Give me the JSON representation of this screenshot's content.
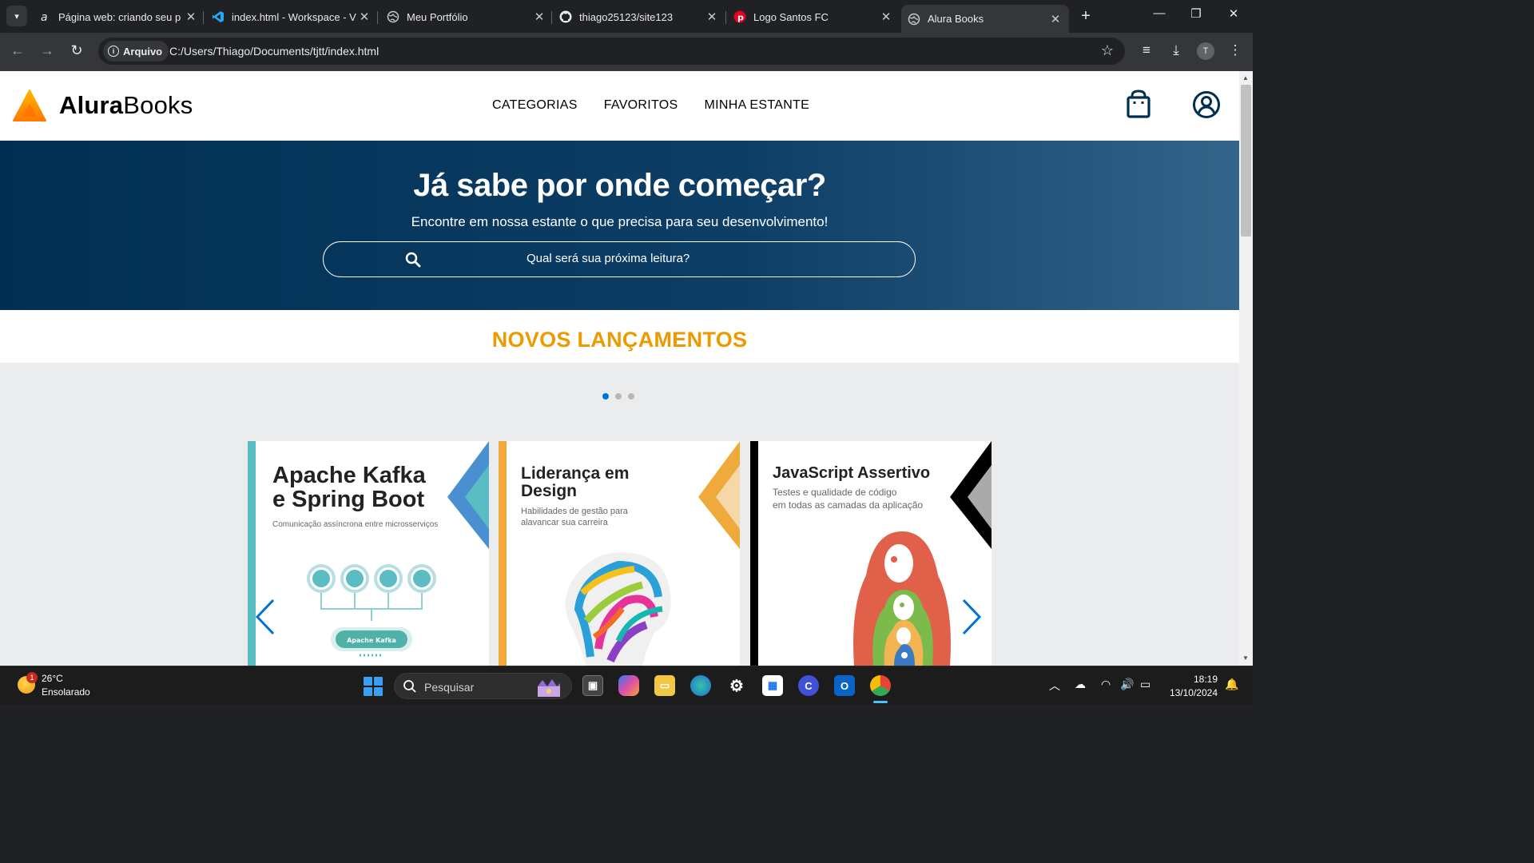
{
  "browser": {
    "tabs": [
      {
        "title": "Página web: criando seu p",
        "icon": "alura-a-icon"
      },
      {
        "title": "index.html - Workspace - V",
        "icon": "vscode-icon"
      },
      {
        "title": "Meu Portfólio",
        "icon": "globe-icon"
      },
      {
        "title": "thiago25123/site123",
        "icon": "github-icon"
      },
      {
        "title": "Logo Santos FC",
        "icon": "pinterest-icon"
      },
      {
        "title": "Alura Books",
        "icon": "globe-icon",
        "active": true
      }
    ],
    "security_chip": "Arquivo",
    "url": "C:/Users/Thiago/Documents/tjtt/index.html",
    "profile_initial": "T"
  },
  "site": {
    "logo_bold": "Alura",
    "logo_regular": "Books",
    "nav": [
      "CATEGORIAS",
      "FAVORITOS",
      "MINHA ESTANTE"
    ],
    "hero": {
      "title": "Já sabe por onde começar?",
      "subtitle": "Encontre em nossa estante o que precisa para seu desenvolvimento!",
      "search_placeholder": "Qual será sua próxima leitura?"
    },
    "section_title": "NOVOS LANÇAMENTOS",
    "carousel": {
      "active_dot": 0,
      "dot_count": 3,
      "books": [
        {
          "title_lines": [
            "Apache Kafka",
            "e Spring Boot"
          ],
          "subtitle_lines": [
            "Comunicação assíncrona entre microsserviços"
          ],
          "accent": "#5bbdc4",
          "diagram_label": "Apache Kafka"
        },
        {
          "title_lines": [
            "Liderança em",
            "Design"
          ],
          "subtitle_lines": [
            "Habilidades de gestão para",
            "alavancar sua carreira"
          ],
          "accent": "#efaa3b"
        },
        {
          "title_lines": [
            "JavaScript Assertivo"
          ],
          "subtitle_lines": [
            "Testes e qualidade de código",
            "em todas as camadas da aplicação"
          ],
          "accent": "#000000"
        }
      ]
    },
    "colors": {
      "brand_dark": "#002f52",
      "accent_orange": "#eb9b00",
      "carousel_blue": "#0072d8"
    }
  },
  "taskbar": {
    "weather_temp": "26°C",
    "weather_desc": "Ensolarado",
    "weather_badge": "1",
    "search_label": "Pesquisar",
    "time": "18:19",
    "date": "13/10/2024"
  }
}
